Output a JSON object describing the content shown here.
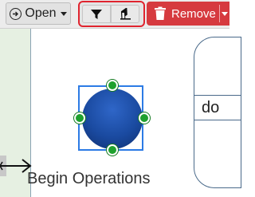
{
  "toolbar": {
    "open_label": "Open",
    "remove_label": "Remove",
    "filter_tool": "filter-icon",
    "eraser_tool": "eraser-icon"
  },
  "canvas": {
    "node_label": "Begin Operations",
    "shape_text": "do"
  },
  "colors": {
    "accent_red": "#d63a3f",
    "selection_blue": "#2c7be5",
    "handle_green": "#1fa12e",
    "node_fill": "#1a4aa0"
  }
}
